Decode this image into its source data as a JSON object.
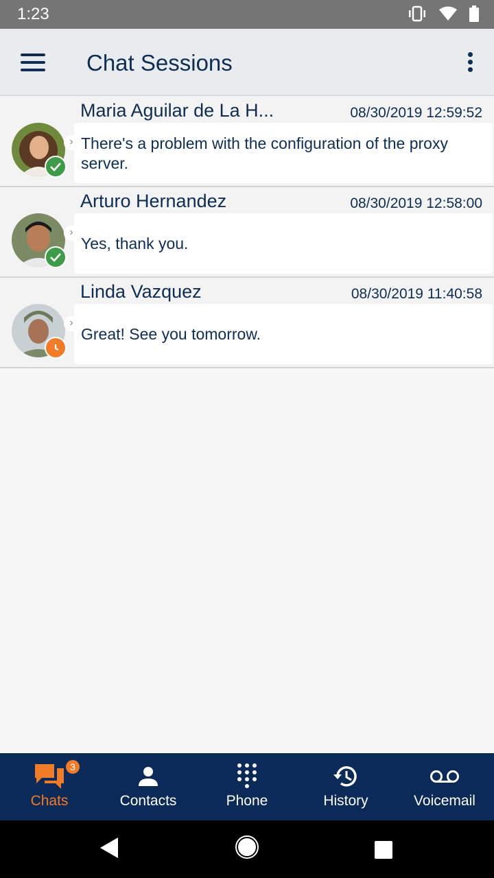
{
  "status_bar": {
    "time": "1:23"
  },
  "app_bar": {
    "title": "Chat Sessions"
  },
  "chats": [
    {
      "name": "Maria Aguilar de La H...",
      "time": "08/30/2019 12:59:52",
      "message": "There's a problem with the configuration of the proxy server.",
      "presence": "available",
      "avatar_color": "#7a5b3a"
    },
    {
      "name": "Arturo Hernandez",
      "time": "08/30/2019 12:58:00",
      "message": "Yes, thank you.",
      "presence": "available",
      "avatar_color": "#5b6b52"
    },
    {
      "name": "Linda Vazquez",
      "time": "08/30/2019 11:40:58",
      "message": "Great! See you tomorrow.",
      "presence": "away",
      "avatar_color": "#4e5a5e"
    }
  ],
  "bottom_nav": [
    {
      "label": "Chats",
      "icon": "chat-icon",
      "badge": "3",
      "active": true
    },
    {
      "label": "Contacts",
      "icon": "person-icon"
    },
    {
      "label": "Phone",
      "icon": "dialpad-icon"
    },
    {
      "label": "History",
      "icon": "history-icon"
    },
    {
      "label": "Voicemail",
      "icon": "voicemail-icon"
    }
  ],
  "colors": {
    "primary": "#0b2a57",
    "accent": "#f07c2a",
    "available": "#3f9b47"
  }
}
